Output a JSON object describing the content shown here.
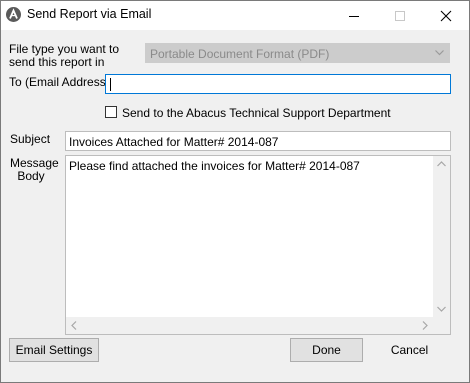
{
  "window": {
    "title": "Send Report via Email",
    "app_icon": "abacus-logo-icon",
    "controls": [
      "minimize-icon",
      "maximize-icon",
      "close-icon"
    ]
  },
  "form": {
    "file_type": {
      "label": "File type you want to send this report in",
      "value": "Portable Document Format (PDF)",
      "disabled": true
    },
    "to": {
      "label": "To (Email Address)",
      "value": ""
    },
    "tech_support": {
      "label": "Send to the Abacus Technical Support Department",
      "checked": false
    },
    "subject": {
      "label": "Subject",
      "value": "Invoices Attached for Matter# 2014-087"
    },
    "message": {
      "label": "Message Body",
      "value": "Please find attached the invoices for Matter# 2014-087"
    }
  },
  "buttons": {
    "email_settings": "Email Settings",
    "done": "Done",
    "cancel": "Cancel"
  },
  "colors": {
    "dialog_bg": "#f0f0f0",
    "focus_border": "#0078d7",
    "disabled_field": "#cccccc",
    "button_face": "#e1e1e1"
  }
}
